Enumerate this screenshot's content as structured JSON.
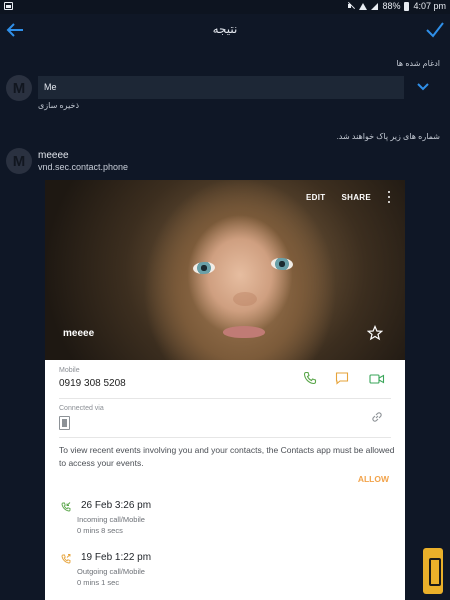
{
  "status_bar": {
    "battery": "88%",
    "time": "4:07 pm",
    "icons": [
      "mute-icon",
      "wifi-icon",
      "signal-icon",
      "battery-icon"
    ]
  },
  "app_bar": {
    "title": "نتیجه",
    "back_icon": "back-arrow-icon",
    "done_icon": "check-icon"
  },
  "merged": {
    "label": "ادغام شده ها",
    "avatar_letter": "M",
    "field_value": "Me",
    "save_text": "ذخیره سازی"
  },
  "to_delete": {
    "label": "شماره های زیر پاک خواهند شد.",
    "avatar_letter": "M",
    "contact_name": "meeee",
    "contact_source": "vnd.sec.contact.phone"
  },
  "card": {
    "edit_label": "EDIT",
    "share_label": "SHARE",
    "name": "meeee",
    "mobile_label": "Mobile",
    "phone": "0919 308 5208",
    "connected_label": "Connected via",
    "notice": "To view recent events involving you and your contacts, the Contacts app must be allowed to access your events.",
    "allow_label": "ALLOW",
    "events": [
      {
        "title": "26 Feb 3:26 pm",
        "type": "Incoming call/Mobile",
        "duration": "0 mins 8 secs"
      },
      {
        "title": "19 Feb 1:22 pm",
        "type": "Outgoing call/Mobile",
        "duration": "0 mins 1 sec"
      }
    ]
  },
  "colors": {
    "background": "#0f1726",
    "accent_blue": "#2f8fe8",
    "allow_orange": "#f2a34a",
    "call_green": "#5aa64a",
    "message_orange": "#e6a33a",
    "video_green": "#3aa65a"
  }
}
